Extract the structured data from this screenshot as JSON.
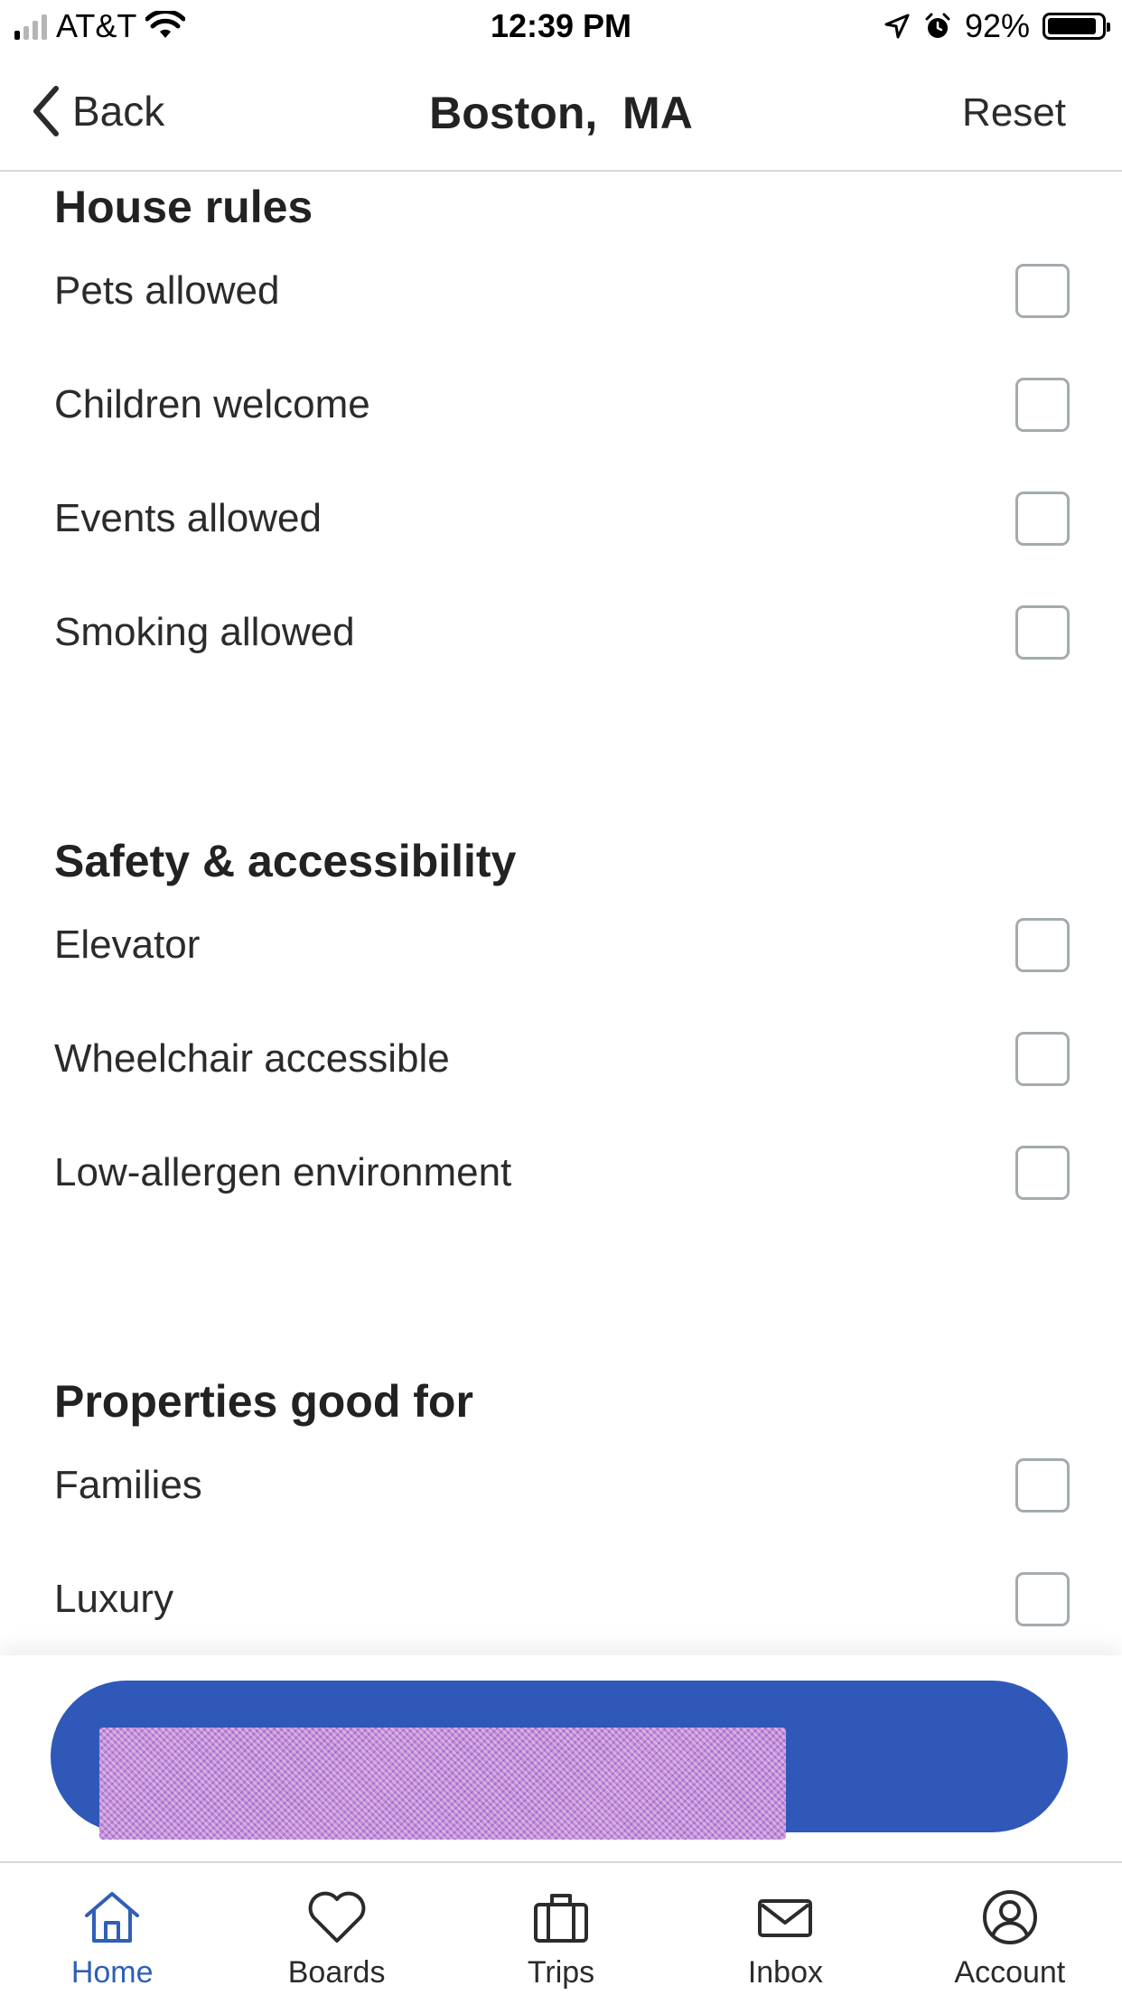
{
  "status_bar": {
    "carrier": "AT&T",
    "time": "12:39 PM",
    "battery": "92%",
    "battery_level": 0.92
  },
  "header": {
    "back_label": "Back",
    "title": "Boston,  MA",
    "reset_label": "Reset"
  },
  "sections": [
    {
      "title": "House rules",
      "options": [
        {
          "label": "Pets allowed",
          "checked": false
        },
        {
          "label": "Children welcome",
          "checked": false
        },
        {
          "label": "Events allowed",
          "checked": false
        },
        {
          "label": "Smoking allowed",
          "checked": false
        }
      ]
    },
    {
      "title": "Safety & accessibility",
      "options": [
        {
          "label": "Elevator",
          "checked": false
        },
        {
          "label": "Wheelchair accessible",
          "checked": false
        },
        {
          "label": "Low-allergen environment",
          "checked": false
        }
      ]
    },
    {
      "title": "Properties good for",
      "options": [
        {
          "label": "Families",
          "checked": false
        },
        {
          "label": "Luxury",
          "checked": false
        }
      ]
    }
  ],
  "colors": {
    "primary": "#2f58b9",
    "active_tab": "#2f5fb6",
    "checkbox_border": "#a4abaf"
  },
  "tabs": [
    {
      "label": "Home",
      "icon": "home-icon",
      "active": true
    },
    {
      "label": "Boards",
      "icon": "heart-icon",
      "active": false
    },
    {
      "label": "Trips",
      "icon": "suitcase-icon",
      "active": false
    },
    {
      "label": "Inbox",
      "icon": "envelope-icon",
      "active": false
    },
    {
      "label": "Account",
      "icon": "account-icon",
      "active": false
    }
  ]
}
